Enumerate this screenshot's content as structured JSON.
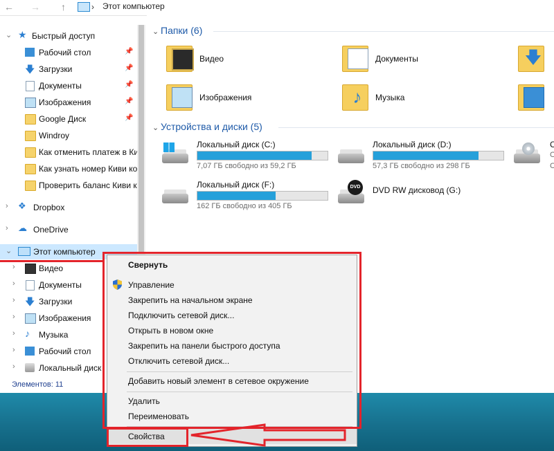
{
  "address": {
    "path": "Этот компьютер"
  },
  "nav": {
    "quick_access": "Быстрый доступ",
    "quick_items": [
      {
        "label": "Рабочий стол"
      },
      {
        "label": "Загрузки"
      },
      {
        "label": "Документы"
      },
      {
        "label": "Изображения"
      },
      {
        "label": "Google Диск"
      },
      {
        "label": "Windroy"
      },
      {
        "label": "Как отменить платеж в Киви"
      },
      {
        "label": "Как узнать номер Киви ко"
      },
      {
        "label": "Проверить баланс Киви к"
      }
    ],
    "dropbox": "Dropbox",
    "onedrive": "OneDrive",
    "this_pc": "Этот компьютер",
    "pc_items": [
      {
        "label": "Видео"
      },
      {
        "label": "Документы"
      },
      {
        "label": "Загрузки"
      },
      {
        "label": "Изображения"
      },
      {
        "label": "Музыка"
      },
      {
        "label": "Рабочий стол"
      },
      {
        "label": "Локальный диск"
      }
    ],
    "status": "Элементов: 11"
  },
  "content": {
    "folders_header": "Папки (6)",
    "folders": [
      {
        "name": "Видео"
      },
      {
        "name": "Документы"
      },
      {
        "name": "Изображения"
      },
      {
        "name": "Музыка"
      }
    ],
    "devices_header": "Устройства и диски (5)",
    "drives": [
      {
        "name": "Локальный диск (C:)",
        "free": "7,07 ГБ свободно из 59,2 ГБ",
        "used_fraction": 0.88
      },
      {
        "name": "Локальный диск (D:)",
        "free": "57,3 ГБ свободно из 298 ГБ",
        "used_fraction": 0.81
      },
      {
        "name": "Локальный диск (F:)",
        "free": "162 ГБ свободно из 405 ГБ",
        "used_fraction": 0.6
      },
      {
        "name": "DVD RW дисковод (G:)"
      }
    ],
    "partial": {
      "c": "С",
      "o": "О",
      "c2": "С"
    }
  },
  "menu": {
    "items": [
      {
        "label": "Свернуть"
      },
      {
        "label": "Управление"
      },
      {
        "label": "Закрепить на начальном экране"
      },
      {
        "label": "Подключить сетевой диск..."
      },
      {
        "label": "Открыть в новом окне"
      },
      {
        "label": "Закрепить на панели быстрого доступа"
      },
      {
        "label": "Отключить сетевой диск..."
      },
      {
        "label": "Добавить новый элемент в сетевое окружение"
      },
      {
        "label": "Удалить"
      },
      {
        "label": "Переименовать"
      },
      {
        "label": "Свойства"
      }
    ]
  },
  "colors": {
    "accent": "#26a0da",
    "annotation": "#e3242b",
    "desktop": "#1b7a98"
  }
}
